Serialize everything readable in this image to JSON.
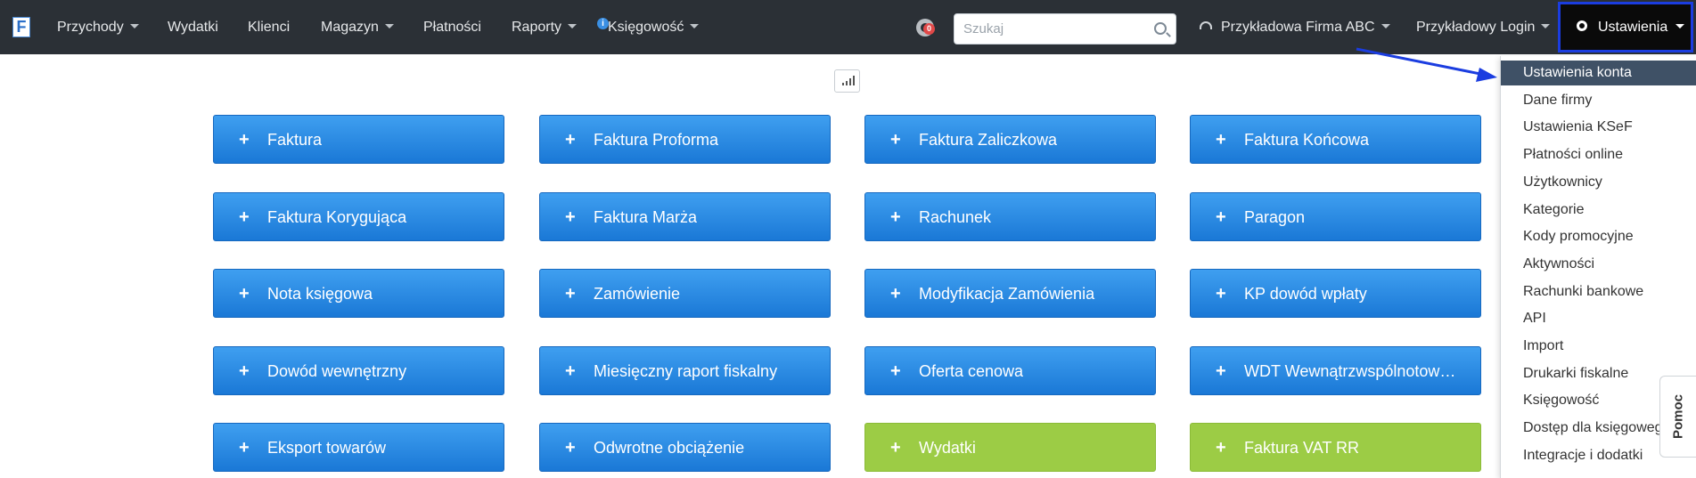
{
  "navbar": {
    "logo": "F",
    "menu": [
      {
        "label": "Przychody",
        "dropdown": true
      },
      {
        "label": "Wydatki",
        "dropdown": false
      },
      {
        "label": "Klienci",
        "dropdown": false
      },
      {
        "label": "Magazyn",
        "dropdown": true
      },
      {
        "label": "Płatności",
        "dropdown": false
      },
      {
        "label": "Raporty",
        "dropdown": true
      },
      {
        "label": "Księgowość",
        "dropdown": true
      }
    ],
    "info_badge": "i",
    "notification_count": "0",
    "search_placeholder": "Szukaj",
    "company": "Przykładowa Firma ABC",
    "login": "Przykładowy Login",
    "settings": "Ustawienia"
  },
  "tiles": [
    {
      "label": "Faktura",
      "color": "blue"
    },
    {
      "label": "Faktura Proforma",
      "color": "blue"
    },
    {
      "label": "Faktura Zaliczkowa",
      "color": "blue"
    },
    {
      "label": "Faktura Końcowa",
      "color": "blue"
    },
    {
      "label": "Faktura Korygująca",
      "color": "blue"
    },
    {
      "label": "Faktura Marża",
      "color": "blue"
    },
    {
      "label": "Rachunek",
      "color": "blue"
    },
    {
      "label": "Paragon",
      "color": "blue"
    },
    {
      "label": "Nota księgowa",
      "color": "blue"
    },
    {
      "label": "Zamówienie",
      "color": "blue"
    },
    {
      "label": "Modyfikacja Zamówienia",
      "color": "blue"
    },
    {
      "label": "KP dowód wpłaty",
      "color": "blue"
    },
    {
      "label": "Dowód wewnętrzny",
      "color": "blue"
    },
    {
      "label": "Miesięczny raport fiskalny",
      "color": "blue"
    },
    {
      "label": "Oferta cenowa",
      "color": "blue"
    },
    {
      "label": "WDT Wewnątrzwspólnotowa Dostawa Towarów",
      "color": "blue"
    },
    {
      "label": "Eksport towarów",
      "color": "blue"
    },
    {
      "label": "Odwrotne obciążenie",
      "color": "blue"
    },
    {
      "label": "Wydatki",
      "color": "green"
    },
    {
      "label": "Faktura VAT RR",
      "color": "green"
    }
  ],
  "plus_icon": "+",
  "settings_menu": {
    "active_index": 0,
    "items": [
      "Ustawienia konta",
      "Dane firmy",
      "Ustawienia KSeF",
      "Płatności online",
      "Użytkownicy",
      "Kategorie",
      "Kody promocyjne",
      "Aktywności",
      "Rachunki bankowe",
      "API",
      "Import",
      "Drukarki fiskalne",
      "Księgowość",
      "Dostęp dla księgowego",
      "Integracje i dodatki"
    ]
  },
  "help_tab": "Pomoc",
  "colors": {
    "navbar": "#2b3036",
    "tile_blue": "#2a8ae6",
    "tile_green": "#9ccc45",
    "dropdown_active": "#3f5166",
    "highlight": "#1b3de0"
  }
}
